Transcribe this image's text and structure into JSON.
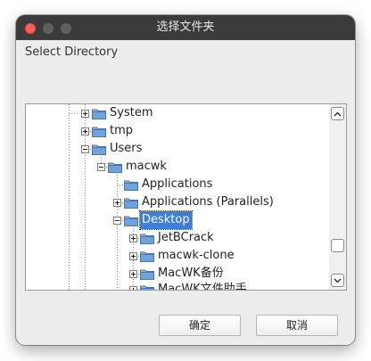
{
  "window": {
    "title": "选择文件夹"
  },
  "prompt": "Select Directory",
  "tree": {
    "items": [
      {
        "label": "System",
        "has_expander": true
      },
      {
        "label": "tmp",
        "has_expander": true
      },
      {
        "label": "Users",
        "has_expander": true
      },
      {
        "label": "macwk",
        "has_expander": true
      },
      {
        "label": "Applications",
        "has_expander": false
      },
      {
        "label": "Applications (Parallels)",
        "has_expander": true
      },
      {
        "label": "Desktop",
        "has_expander": true,
        "selected": true
      },
      {
        "label": "JetBCrack",
        "has_expander": true
      },
      {
        "label": "macwk-clone",
        "has_expander": true
      },
      {
        "label": "MacWK备份",
        "has_expander": true
      },
      {
        "label": "MacWK文件助手",
        "has_expander": true,
        "partially_visible": true
      }
    ]
  },
  "buttons": {
    "ok": "确定",
    "cancel": "取消"
  },
  "colors": {
    "titlebar": "#3b3b3b",
    "selection": "#3d7ed8",
    "folder": "#6fa3dc"
  },
  "icons": {
    "folder": "folder-icon",
    "expander": "plus-expander-icon",
    "scroll_up": "chevron-up-icon",
    "scroll_down": "chevron-down-icon"
  }
}
